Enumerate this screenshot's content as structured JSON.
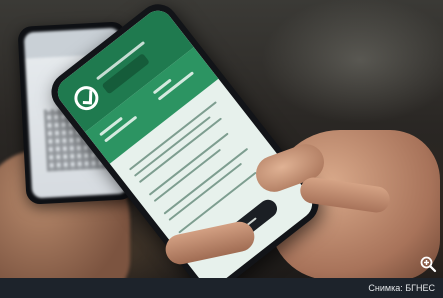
{
  "credit": {
    "text": "Снимка: БГНЕС"
  },
  "controls": {
    "zoom_icon": "zoom-in-icon"
  },
  "colors": {
    "app_green_dark": "#1f7a4f",
    "app_green": "#2c9462",
    "credit_bar": "#1d232b"
  }
}
